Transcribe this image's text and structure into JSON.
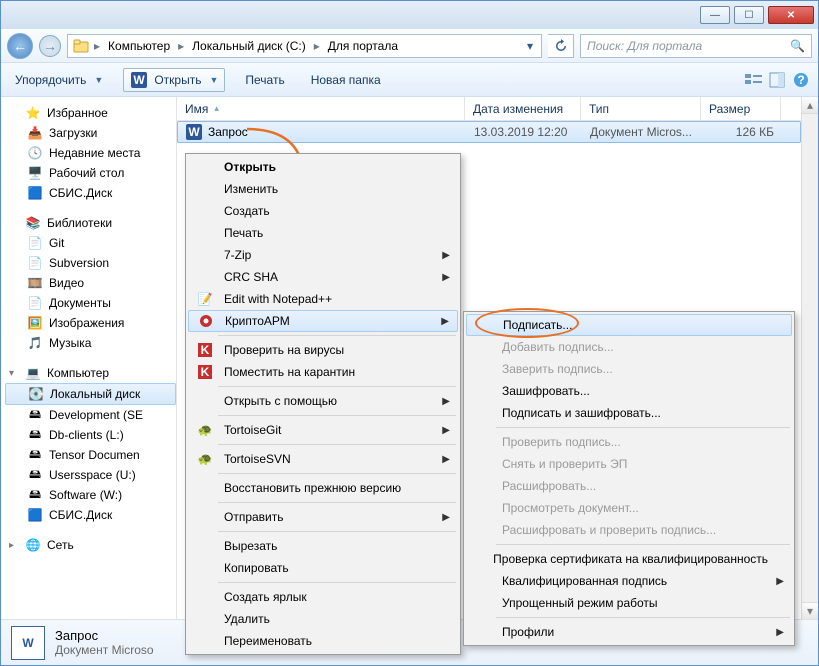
{
  "breadcrumbs": {
    "computer": "Компьютер",
    "drive": "Локальный диск (C:)",
    "folder": "Для портала"
  },
  "search": {
    "placeholder": "Поиск: Для портала"
  },
  "toolbar": {
    "organize": "Упорядочить",
    "open": "Открыть",
    "print": "Печать",
    "new_folder": "Новая папка"
  },
  "columns": {
    "name": "Имя",
    "date": "Дата изменения",
    "type": "Тип",
    "size": "Размер"
  },
  "file": {
    "name": "Запрос",
    "date": "13.03.2019 12:20",
    "type": "Документ Micros...",
    "size": "126 КБ"
  },
  "sidebar": {
    "favorites": {
      "title": "Избранное",
      "downloads": "Загрузки",
      "recent": "Недавние места",
      "desktop": "Рабочий стол",
      "sbisdisk": "СБИС.Диск"
    },
    "libraries": {
      "title": "Библиотеки",
      "git": "Git",
      "svn": "Subversion",
      "video": "Видео",
      "docs": "Документы",
      "pics": "Изображения",
      "music": "Музыка"
    },
    "computer": {
      "title": "Компьютер",
      "c": "Локальный диск",
      "dev": "Development (SE",
      "db": "Db-clients (L:)",
      "tensor": "Tensor Documen",
      "users": "Usersspace (U:)",
      "soft": "Software (W:)",
      "sbis": "СБИС.Диск"
    },
    "network": {
      "title": "Сеть"
    }
  },
  "ctx1": {
    "open": "Открыть",
    "edit": "Изменить",
    "create": "Создать",
    "print": "Печать",
    "sevenzip": "7-Zip",
    "crc": "CRC SHA",
    "npp": "Edit with Notepad++",
    "cryptoarm": "КриптоАРМ",
    "av_check": "Проверить на вирусы",
    "av_quar": "Поместить на карантин",
    "openwith": "Открыть с помощью",
    "tgit": "TortoiseGit",
    "tsvn": "TortoiseSVN",
    "restore": "Восстановить прежнюю версию",
    "sendto": "Отправить",
    "cut": "Вырезать",
    "copy": "Копировать",
    "shortcut": "Создать ярлык",
    "delete": "Удалить",
    "rename": "Переименовать"
  },
  "ctx2": {
    "sign": "Подписать...",
    "addsig": "Добавить подпись...",
    "certsig": "Заверить подпись...",
    "encrypt": "Зашифровать...",
    "signenc": "Подписать и зашифровать...",
    "verify": "Проверить подпись...",
    "unsign": "Снять и проверить ЭП",
    "decrypt": "Расшифровать...",
    "viewdoc": "Просмотреть документ...",
    "decver": "Расшифровать и проверить подпись...",
    "certq": "Проверка сертификата на квалифицированность",
    "qsig": "Квалифицированная подпись",
    "simple": "Упрощенный режим работы",
    "profiles": "Профили"
  },
  "details": {
    "name": "Запрос",
    "type": "Документ Microso"
  }
}
